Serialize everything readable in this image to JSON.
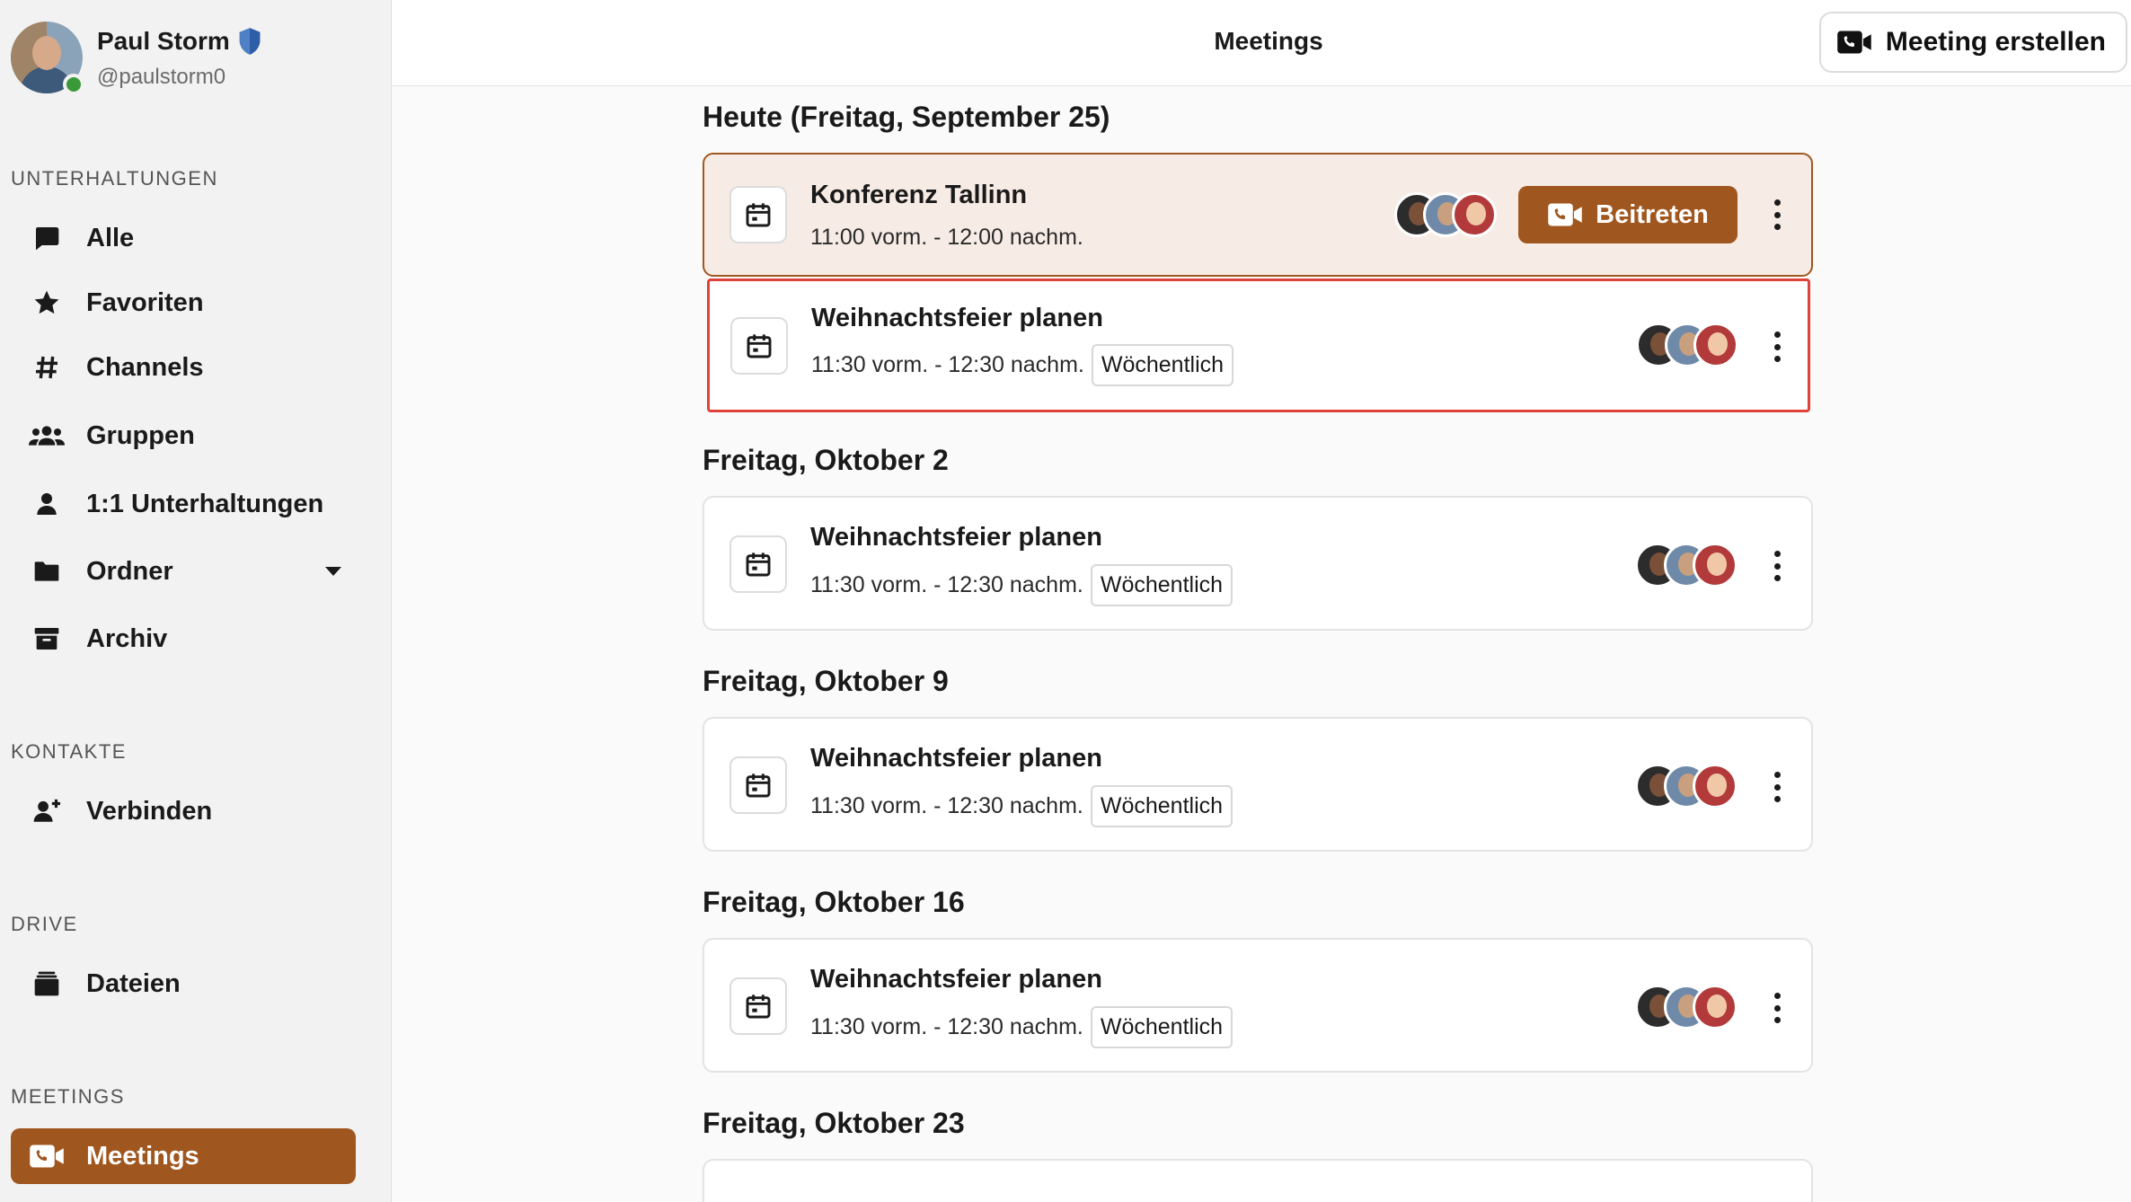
{
  "profile": {
    "name": "Paul Storm",
    "handle": "@paulstorm0"
  },
  "sidebar": {
    "sections": {
      "conversations": "UNTERHALTUNGEN",
      "contacts": "KONTAKTE",
      "drive": "DRIVE",
      "meetings": "MEETINGS"
    },
    "items": [
      {
        "label": "Alle",
        "icon": "chat-bubble-icon"
      },
      {
        "label": "Favoriten",
        "icon": "star-icon"
      },
      {
        "label": "Channels",
        "icon": "hash-icon"
      },
      {
        "label": "Gruppen",
        "icon": "group-icon"
      },
      {
        "label": "1:1 Unterhaltungen",
        "icon": "person-icon"
      },
      {
        "label": "Ordner",
        "icon": "folder-icon"
      },
      {
        "label": "Archiv",
        "icon": "archive-icon"
      },
      {
        "label": "Verbinden",
        "icon": "add-person-icon"
      },
      {
        "label": "Dateien",
        "icon": "files-icon"
      },
      {
        "label": "Meetings",
        "icon": "video-call-icon",
        "active": true
      }
    ]
  },
  "header": {
    "title": "Meetings",
    "create_label": "Meeting erstellen"
  },
  "days": [
    {
      "heading": "Heute (Freitag, September 25)",
      "meetings": [
        {
          "title": "Konferenz Tallinn",
          "time": "11:00 vorm. - 12:00 nachm.",
          "join_label": "Beitreten",
          "status": "live"
        },
        {
          "title": "Weihnachtsfeier planen",
          "time": "11:30 vorm. - 12:30 nachm.",
          "recurrence": "Wöchentlich",
          "status": "selected"
        }
      ]
    },
    {
      "heading": "Freitag, Oktober 2",
      "meetings": [
        {
          "title": "Weihnachtsfeier planen",
          "time": "11:30 vorm. - 12:30 nachm.",
          "recurrence": "Wöchentlich"
        }
      ]
    },
    {
      "heading": "Freitag, Oktober 9",
      "meetings": [
        {
          "title": "Weihnachtsfeier planen",
          "time": "11:30 vorm. - 12:30 nachm.",
          "recurrence": "Wöchentlich"
        }
      ]
    },
    {
      "heading": "Freitag, Oktober 16",
      "meetings": [
        {
          "title": "Weihnachtsfeier planen",
          "time": "11:30 vorm. - 12:30 nachm.",
          "recurrence": "Wöchentlich"
        }
      ]
    },
    {
      "heading": "Freitag, Oktober 23",
      "meetings": []
    }
  ],
  "colors": {
    "accent": "#a0561f",
    "live_card_bg": "#f7ece5",
    "selection_outline": "#e0413b",
    "online": "#3a9a3a"
  }
}
